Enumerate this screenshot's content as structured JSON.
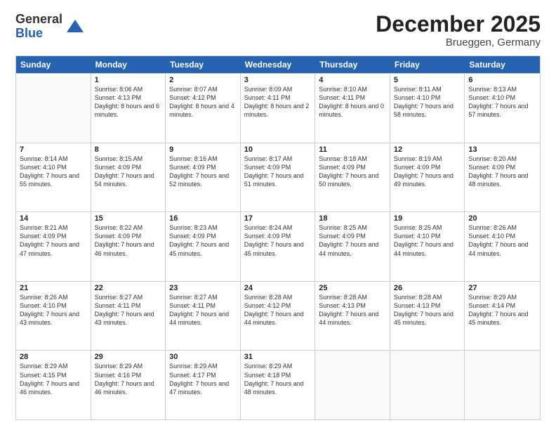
{
  "header": {
    "logo_line1": "General",
    "logo_line2": "Blue",
    "month": "December 2025",
    "location": "Brueggen, Germany"
  },
  "days_of_week": [
    "Sunday",
    "Monday",
    "Tuesday",
    "Wednesday",
    "Thursday",
    "Friday",
    "Saturday"
  ],
  "weeks": [
    [
      {
        "day": "",
        "sunrise": "",
        "sunset": "",
        "daylight": ""
      },
      {
        "day": "1",
        "sunrise": "Sunrise: 8:06 AM",
        "sunset": "Sunset: 4:13 PM",
        "daylight": "Daylight: 8 hours and 6 minutes."
      },
      {
        "day": "2",
        "sunrise": "Sunrise: 8:07 AM",
        "sunset": "Sunset: 4:12 PM",
        "daylight": "Daylight: 8 hours and 4 minutes."
      },
      {
        "day": "3",
        "sunrise": "Sunrise: 8:09 AM",
        "sunset": "Sunset: 4:11 PM",
        "daylight": "Daylight: 8 hours and 2 minutes."
      },
      {
        "day": "4",
        "sunrise": "Sunrise: 8:10 AM",
        "sunset": "Sunset: 4:11 PM",
        "daylight": "Daylight: 8 hours and 0 minutes."
      },
      {
        "day": "5",
        "sunrise": "Sunrise: 8:11 AM",
        "sunset": "Sunset: 4:10 PM",
        "daylight": "Daylight: 7 hours and 58 minutes."
      },
      {
        "day": "6",
        "sunrise": "Sunrise: 8:13 AM",
        "sunset": "Sunset: 4:10 PM",
        "daylight": "Daylight: 7 hours and 57 minutes."
      }
    ],
    [
      {
        "day": "7",
        "sunrise": "Sunrise: 8:14 AM",
        "sunset": "Sunset: 4:10 PM",
        "daylight": "Daylight: 7 hours and 55 minutes."
      },
      {
        "day": "8",
        "sunrise": "Sunrise: 8:15 AM",
        "sunset": "Sunset: 4:09 PM",
        "daylight": "Daylight: 7 hours and 54 minutes."
      },
      {
        "day": "9",
        "sunrise": "Sunrise: 8:16 AM",
        "sunset": "Sunset: 4:09 PM",
        "daylight": "Daylight: 7 hours and 52 minutes."
      },
      {
        "day": "10",
        "sunrise": "Sunrise: 8:17 AM",
        "sunset": "Sunset: 4:09 PM",
        "daylight": "Daylight: 7 hours and 51 minutes."
      },
      {
        "day": "11",
        "sunrise": "Sunrise: 8:18 AM",
        "sunset": "Sunset: 4:09 PM",
        "daylight": "Daylight: 7 hours and 50 minutes."
      },
      {
        "day": "12",
        "sunrise": "Sunrise: 8:19 AM",
        "sunset": "Sunset: 4:09 PM",
        "daylight": "Daylight: 7 hours and 49 minutes."
      },
      {
        "day": "13",
        "sunrise": "Sunrise: 8:20 AM",
        "sunset": "Sunset: 4:09 PM",
        "daylight": "Daylight: 7 hours and 48 minutes."
      }
    ],
    [
      {
        "day": "14",
        "sunrise": "Sunrise: 8:21 AM",
        "sunset": "Sunset: 4:09 PM",
        "daylight": "Daylight: 7 hours and 47 minutes."
      },
      {
        "day": "15",
        "sunrise": "Sunrise: 8:22 AM",
        "sunset": "Sunset: 4:09 PM",
        "daylight": "Daylight: 7 hours and 46 minutes."
      },
      {
        "day": "16",
        "sunrise": "Sunrise: 8:23 AM",
        "sunset": "Sunset: 4:09 PM",
        "daylight": "Daylight: 7 hours and 45 minutes."
      },
      {
        "day": "17",
        "sunrise": "Sunrise: 8:24 AM",
        "sunset": "Sunset: 4:09 PM",
        "daylight": "Daylight: 7 hours and 45 minutes."
      },
      {
        "day": "18",
        "sunrise": "Sunrise: 8:25 AM",
        "sunset": "Sunset: 4:09 PM",
        "daylight": "Daylight: 7 hours and 44 minutes."
      },
      {
        "day": "19",
        "sunrise": "Sunrise: 8:25 AM",
        "sunset": "Sunset: 4:10 PM",
        "daylight": "Daylight: 7 hours and 44 minutes."
      },
      {
        "day": "20",
        "sunrise": "Sunrise: 8:26 AM",
        "sunset": "Sunset: 4:10 PM",
        "daylight": "Daylight: 7 hours and 44 minutes."
      }
    ],
    [
      {
        "day": "21",
        "sunrise": "Sunrise: 8:26 AM",
        "sunset": "Sunset: 4:10 PM",
        "daylight": "Daylight: 7 hours and 43 minutes."
      },
      {
        "day": "22",
        "sunrise": "Sunrise: 8:27 AM",
        "sunset": "Sunset: 4:11 PM",
        "daylight": "Daylight: 7 hours and 43 minutes."
      },
      {
        "day": "23",
        "sunrise": "Sunrise: 8:27 AM",
        "sunset": "Sunset: 4:11 PM",
        "daylight": "Daylight: 7 hours and 44 minutes."
      },
      {
        "day": "24",
        "sunrise": "Sunrise: 8:28 AM",
        "sunset": "Sunset: 4:12 PM",
        "daylight": "Daylight: 7 hours and 44 minutes."
      },
      {
        "day": "25",
        "sunrise": "Sunrise: 8:28 AM",
        "sunset": "Sunset: 4:13 PM",
        "daylight": "Daylight: 7 hours and 44 minutes."
      },
      {
        "day": "26",
        "sunrise": "Sunrise: 8:28 AM",
        "sunset": "Sunset: 4:13 PM",
        "daylight": "Daylight: 7 hours and 45 minutes."
      },
      {
        "day": "27",
        "sunrise": "Sunrise: 8:29 AM",
        "sunset": "Sunset: 4:14 PM",
        "daylight": "Daylight: 7 hours and 45 minutes."
      }
    ],
    [
      {
        "day": "28",
        "sunrise": "Sunrise: 8:29 AM",
        "sunset": "Sunset: 4:15 PM",
        "daylight": "Daylight: 7 hours and 46 minutes."
      },
      {
        "day": "29",
        "sunrise": "Sunrise: 8:29 AM",
        "sunset": "Sunset: 4:16 PM",
        "daylight": "Daylight: 7 hours and 46 minutes."
      },
      {
        "day": "30",
        "sunrise": "Sunrise: 8:29 AM",
        "sunset": "Sunset: 4:17 PM",
        "daylight": "Daylight: 7 hours and 47 minutes."
      },
      {
        "day": "31",
        "sunrise": "Sunrise: 8:29 AM",
        "sunset": "Sunset: 4:18 PM",
        "daylight": "Daylight: 7 hours and 48 minutes."
      },
      {
        "day": "",
        "sunrise": "",
        "sunset": "",
        "daylight": ""
      },
      {
        "day": "",
        "sunrise": "",
        "sunset": "",
        "daylight": ""
      },
      {
        "day": "",
        "sunrise": "",
        "sunset": "",
        "daylight": ""
      }
    ]
  ]
}
